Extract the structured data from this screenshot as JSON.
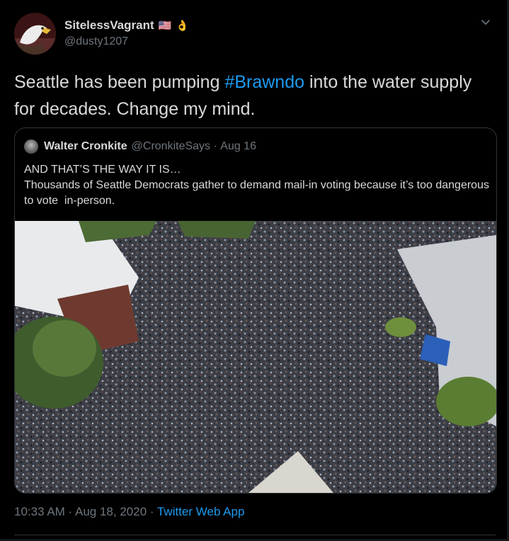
{
  "author": {
    "display_name": "SitelessVagrant",
    "flag_emoji": "🇺🇸",
    "hand_emoji": "👌",
    "handle": "@dusty1207"
  },
  "tweet": {
    "text_before": "Seattle has been pumping ",
    "hashtag": "#Brawndo",
    "text_after": " into the water supply for decades. Change my mind."
  },
  "quoted_tweet": {
    "display_name": "Walter Cronkite",
    "handle": "@CronkiteSays",
    "separator": " · ",
    "date": "Aug 16",
    "line1": "AND THAT’S THE WAY IT IS…",
    "line2": "Thousands of Seattle Democrats gather to demand mail-in voting because it’s too dangerous to vote  in-person."
  },
  "footer": {
    "time": "10:33 AM",
    "separator1": " · ",
    "date": "Aug 18, 2020",
    "separator2": " · ",
    "app": "Twitter Web App"
  },
  "colors": {
    "background": "#000000",
    "text": "#d9d9d9",
    "muted": "#6e767d",
    "link": "#1d9bf0",
    "border": "#2f3336"
  },
  "icons": {
    "more": "chevron-down-icon"
  }
}
